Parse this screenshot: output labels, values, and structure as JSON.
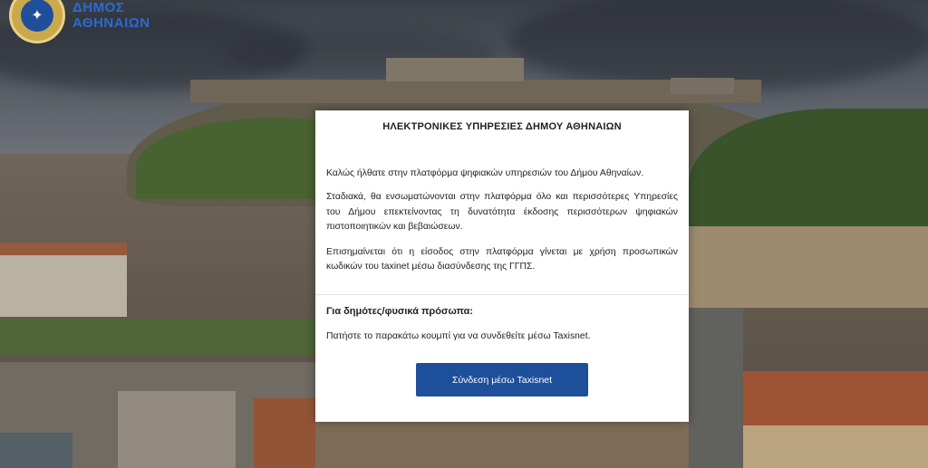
{
  "logo": {
    "line1": "ΔΗΜΟΣ",
    "line2": "ΑΘΗΝΑΙΩΝ",
    "icon": "municipality-emblem"
  },
  "modal": {
    "title": "ΗΛΕΚΤΡΟΝΙΚΕΣ ΥΠΗΡΕΣΙΕΣ ΔΗΜΟΥ ΑΘΗΝΑΙΩΝ",
    "welcome": "Καλώς ήλθατε στην πλατφόρμα ψηφιακών υπηρεσιών του Δήμου Αθηναίων.",
    "paragraph2": "Σταδιακά, θα ενσωματώνονται στην πλατφόρμα όλο και περισσότερες Υπηρεσίες του Δήμου επεκτείνοντας τη δυνατότητα έκδοσης περισσότερων ψηφιακών πιστοποιητικών και βεβαιώσεων.",
    "paragraph3": "Επισημαίνεται ότι η είσοδος στην πλατφόρμα γίνεται με χρήση προσωπικών κωδικών του taxinet μέσω διασύνδεσης της ΓΓΠΣ.",
    "section_heading": "Για δημότες/φυσικά πρόσωπα:",
    "section_text": "Πατήστε το παρακάτω κουμπί για να συνδεθείτε μέσω Taxisnet.",
    "button_label": "Σύνδεση μέσω Taxisnet"
  },
  "colors": {
    "button": "#1e4f9a",
    "logo_text": "#2a6cd1"
  }
}
